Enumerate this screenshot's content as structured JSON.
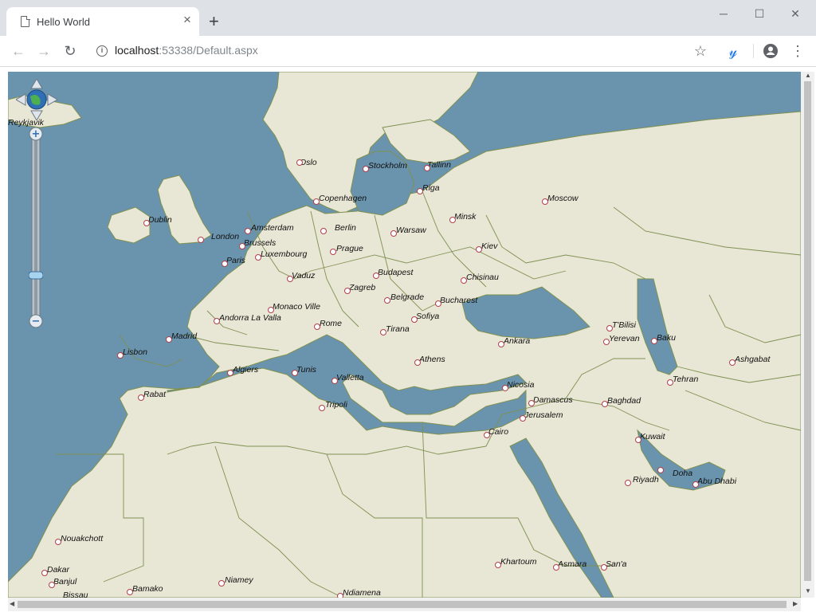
{
  "browser": {
    "tab_title": "Hello World",
    "url_host": "localhost",
    "url_rest": ":53338/Default.aspx"
  },
  "map": {
    "colors": {
      "water": "#6a93ad",
      "land": "#e8e6d4",
      "border": "#7f9152"
    },
    "cities": [
      {
        "name": "Reykjavik"
      },
      {
        "name": "Oslo"
      },
      {
        "name": "Stockholm"
      },
      {
        "name": "Tallinn"
      },
      {
        "name": "Riga"
      },
      {
        "name": "Copenhagen"
      },
      {
        "name": "Moscow"
      },
      {
        "name": "Dublin"
      },
      {
        "name": "Minsk"
      },
      {
        "name": "Amsterdam"
      },
      {
        "name": "Berlin"
      },
      {
        "name": "Warsaw"
      },
      {
        "name": "London"
      },
      {
        "name": "Brussels"
      },
      {
        "name": "Luxembourg"
      },
      {
        "name": "Prague"
      },
      {
        "name": "Kiev"
      },
      {
        "name": "Paris"
      },
      {
        "name": "Vaduz"
      },
      {
        "name": "Budapest"
      },
      {
        "name": "Chisinau"
      },
      {
        "name": "Zagreb"
      },
      {
        "name": "Belgrade"
      },
      {
        "name": "Bucharest"
      },
      {
        "name": "Monaco Ville"
      },
      {
        "name": "Andorra La Valla"
      },
      {
        "name": "Sofiya"
      },
      {
        "name": "Rome"
      },
      {
        "name": "Tirana"
      },
      {
        "name": "T'Bilisi"
      },
      {
        "name": "Madrid"
      },
      {
        "name": "Ankara"
      },
      {
        "name": "Yerevan"
      },
      {
        "name": "Baku"
      },
      {
        "name": "Lisbon"
      },
      {
        "name": "Athens"
      },
      {
        "name": "Ashgabat"
      },
      {
        "name": "Algiers"
      },
      {
        "name": "Tunis"
      },
      {
        "name": "Valletta"
      },
      {
        "name": "Tehran"
      },
      {
        "name": "Nicosia"
      },
      {
        "name": "Rabat"
      },
      {
        "name": "Damascus"
      },
      {
        "name": "Baghdad"
      },
      {
        "name": "Tripoli"
      },
      {
        "name": "Jerusalem"
      },
      {
        "name": "Cairo"
      },
      {
        "name": "Kuwait"
      },
      {
        "name": "Riyadh"
      },
      {
        "name": "Doha"
      },
      {
        "name": "Abu Dhabi"
      },
      {
        "name": "Nouakchott"
      },
      {
        "name": "Khartoum"
      },
      {
        "name": "Asmara"
      },
      {
        "name": "San'a"
      },
      {
        "name": "Dakar"
      },
      {
        "name": "Banjul"
      },
      {
        "name": "Niamey"
      },
      {
        "name": "Bamako"
      },
      {
        "name": "Ndiamena"
      },
      {
        "name": "Bissau"
      }
    ]
  }
}
